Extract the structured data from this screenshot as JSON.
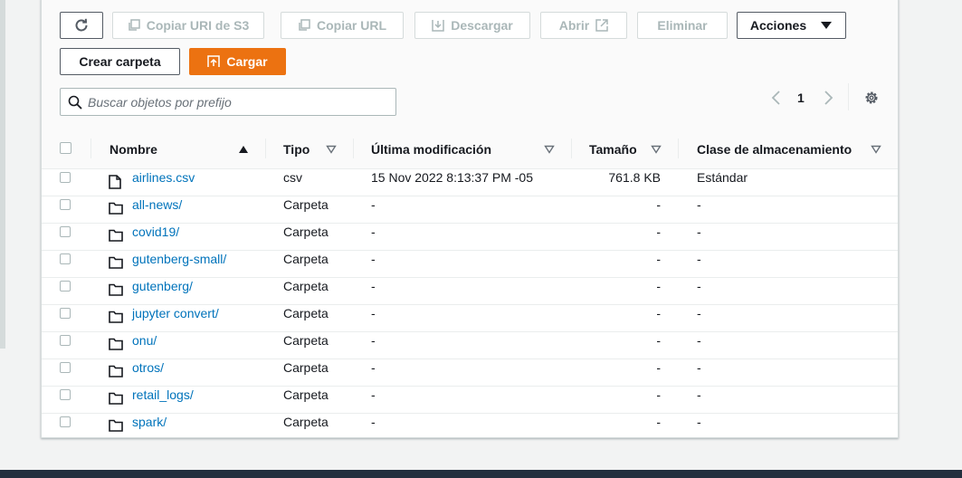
{
  "toolbar": {
    "refresh_icon": "refresh-icon",
    "copy_s3_uri": "Copiar URI de S3",
    "copy_url": "Copiar URL",
    "download": "Descargar",
    "open": "Abrir",
    "delete": "Eliminar",
    "actions": "Acciones",
    "create_folder": "Crear carpeta",
    "upload": "Cargar"
  },
  "search": {
    "placeholder": "Buscar objetos por prefijo"
  },
  "pagination": {
    "current_page": "1"
  },
  "table": {
    "columns": [
      "Nombre",
      "Tipo",
      "Última modificación",
      "Tamaño",
      "Clase de almacenamiento"
    ],
    "rows": [
      {
        "name": "airlines.csv",
        "type": "csv",
        "modified": "15 Nov 2022 8:13:37 PM -05",
        "size": "761.8 KB",
        "storage": "Estándar",
        "icon": "file-icon"
      },
      {
        "name": "all-news/",
        "type": "Carpeta",
        "modified": "-",
        "size": "-",
        "storage": "-",
        "icon": "folder-icon"
      },
      {
        "name": "covid19/",
        "type": "Carpeta",
        "modified": "-",
        "size": "-",
        "storage": "-",
        "icon": "folder-icon"
      },
      {
        "name": "gutenberg-small/",
        "type": "Carpeta",
        "modified": "-",
        "size": "-",
        "storage": "-",
        "icon": "folder-icon"
      },
      {
        "name": "gutenberg/",
        "type": "Carpeta",
        "modified": "-",
        "size": "-",
        "storage": "-",
        "icon": "folder-icon"
      },
      {
        "name": "jupyter convert/",
        "type": "Carpeta",
        "modified": "-",
        "size": "-",
        "storage": "-",
        "icon": "folder-icon"
      },
      {
        "name": "onu/",
        "type": "Carpeta",
        "modified": "-",
        "size": "-",
        "storage": "-",
        "icon": "folder-icon"
      },
      {
        "name": "otros/",
        "type": "Carpeta",
        "modified": "-",
        "size": "-",
        "storage": "-",
        "icon": "folder-icon"
      },
      {
        "name": "retail_logs/",
        "type": "Carpeta",
        "modified": "-",
        "size": "-",
        "storage": "-",
        "icon": "folder-icon"
      },
      {
        "name": "spark/",
        "type": "Carpeta",
        "modified": "-",
        "size": "-",
        "storage": "-",
        "icon": "folder-icon"
      }
    ]
  },
  "colors": {
    "primary": "#ec7211",
    "link": "#0073bb",
    "text": "#16191f",
    "disabled": "#aab7b8",
    "border": "#545b64"
  }
}
